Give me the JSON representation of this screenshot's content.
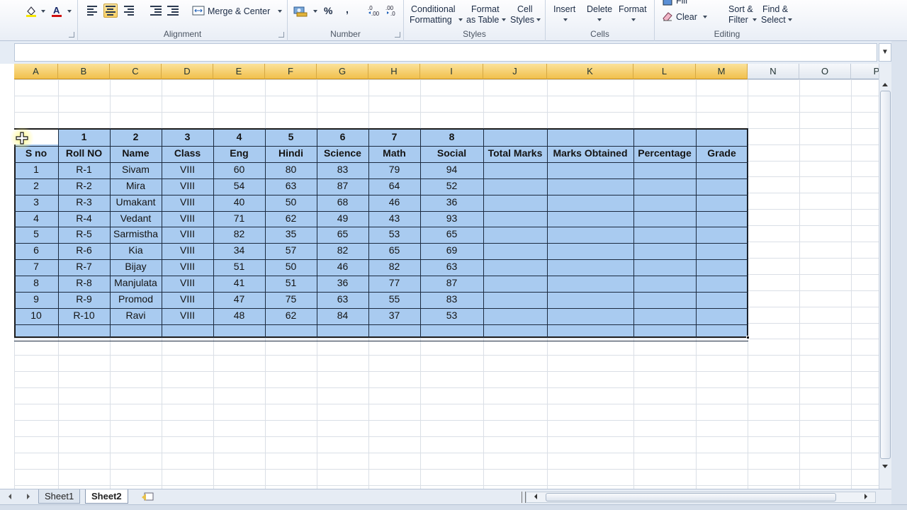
{
  "ribbon": {
    "merge_center_label": "Merge & Center",
    "percent_label": "%",
    "comma_label": ",",
    "conditional_formatting": [
      "Conditional",
      "Formatting"
    ],
    "format_as_table": [
      "Format",
      "as Table"
    ],
    "cell_styles": [
      "Cell",
      "Styles"
    ],
    "insert_label": "Insert",
    "delete_label": "Delete",
    "format_label": "Format",
    "fill_label": "Fill",
    "clear_label": "Clear",
    "sort_filter": [
      "Sort &",
      "Filter"
    ],
    "find_select": [
      "Find &",
      "Select"
    ],
    "groups": {
      "alignment": "Alignment",
      "number": "Number",
      "styles": "Styles",
      "cells": "Cells",
      "editing": "Editing"
    }
  },
  "grid": {
    "columns": [
      "A",
      "B",
      "C",
      "D",
      "E",
      "F",
      "G",
      "H",
      "I",
      "J",
      "K",
      "L",
      "M",
      "N",
      "O",
      "P"
    ],
    "number_row": [
      "1",
      "2",
      "3",
      "4",
      "5",
      "6",
      "7",
      "8"
    ],
    "headers": [
      "S no",
      "Roll NO",
      "Name",
      "Class",
      "Eng",
      "Hindi",
      "Science",
      "Math",
      "Social",
      "Total Marks",
      "Marks Obtained",
      "Percentage",
      "Grade"
    ],
    "rows": [
      [
        "1",
        "R-1",
        "Sivam",
        "VIII",
        "60",
        "80",
        "83",
        "79",
        "94"
      ],
      [
        "2",
        "R-2",
        "Mira",
        "VIII",
        "54",
        "63",
        "87",
        "64",
        "52"
      ],
      [
        "3",
        "R-3",
        "Umakant",
        "VIII",
        "40",
        "50",
        "68",
        "46",
        "36"
      ],
      [
        "4",
        "R-4",
        "Vedant",
        "VIII",
        "71",
        "62",
        "49",
        "43",
        "93"
      ],
      [
        "5",
        "R-5",
        "Sarmistha",
        "VIII",
        "82",
        "35",
        "65",
        "53",
        "65"
      ],
      [
        "6",
        "R-6",
        "Kia",
        "VIII",
        "34",
        "57",
        "82",
        "65",
        "69"
      ],
      [
        "7",
        "R-7",
        "Bijay",
        "VIII",
        "51",
        "50",
        "46",
        "82",
        "63"
      ],
      [
        "8",
        "R-8",
        "Manjulata",
        "VIII",
        "41",
        "51",
        "36",
        "77",
        "87"
      ],
      [
        "9",
        "R-9",
        "Promod",
        "VIII",
        "47",
        "75",
        "63",
        "55",
        "83"
      ],
      [
        "10",
        "R-10",
        "Ravi",
        "VIII",
        "48",
        "62",
        "84",
        "37",
        "53"
      ]
    ]
  },
  "sheets": [
    "Sheet1",
    "Sheet2"
  ],
  "colors": {
    "selection_fill": "#a9cbf0",
    "selected_header": "#f1c04c",
    "table_border": "#1b2a3f"
  }
}
